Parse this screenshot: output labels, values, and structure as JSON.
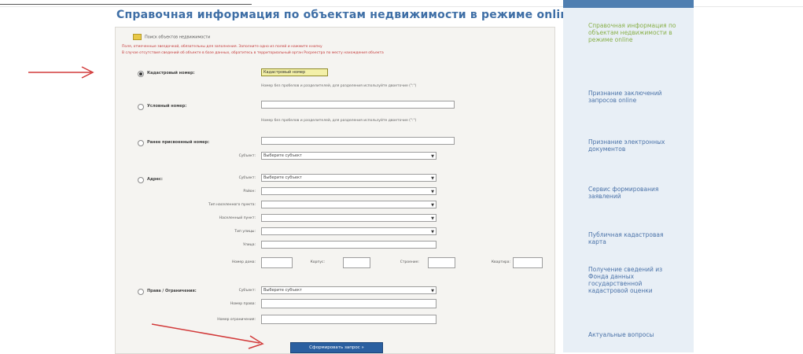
{
  "page_title": "Справочная информация по объектам недвижимости в режиме online",
  "hint": "Поиск объектов недвижимости",
  "notices": [
    "Поля, отмеченные звездочкой, обязательны для заполнения. Заполните одно из полей и нажмите кнопку",
    "В случае отсутствия сведений об объекте в базе данных, обратитесь в территориальный орган Росреестра по месту нахождения объекта"
  ],
  "form": {
    "cadastral": {
      "label": "Кадастровый номер:",
      "value": "Кадастровый номер",
      "hint": "Номер без пробелов и разделителей, для разделения используйте двоеточие (\":\")"
    },
    "conditional": {
      "label": "Условный номер:",
      "hint": "Номер без пробелов и разделителей, для разделения используйте двоеточие (\":\")"
    },
    "old_number": {
      "label": "Ранее присвоенный номер:",
      "subject_label": "Субъект:",
      "subject_value": "Выберите субъект"
    },
    "address": {
      "label": "Адрес:",
      "rows": [
        {
          "label": "Субъект:",
          "value": "Выберите субъект",
          "type": "select"
        },
        {
          "label": "Район:",
          "value": "",
          "type": "select"
        },
        {
          "label": "Тип населенного пункта:",
          "value": "",
          "type": "select"
        },
        {
          "label": "Населенный пункт:",
          "value": "",
          "type": "select"
        },
        {
          "label": "Тип улицы:",
          "value": "",
          "type": "select"
        },
        {
          "label": "Улица:",
          "value": "",
          "type": "input"
        }
      ],
      "house_label": "Номер дома:",
      "corpus_label": "Корпус:",
      "building_label": "Строение:",
      "apartment_label": "Квартира:"
    },
    "rights": {
      "label": "Права / Ограничения:",
      "subject_label": "Субъект:",
      "subject_value": "Выберите субъект",
      "right_number_label": "Номер права:",
      "restriction_number_label": "Номер ограничения:"
    },
    "submit_label": "Сформировать запрос »"
  },
  "sidebar": {
    "items": [
      {
        "label": "Справочная информация по объектам недвижимости в режиме online",
        "active": true
      },
      {
        "label": "Признание заключений запросов online",
        "active": false
      },
      {
        "label": "Признание электронных документов",
        "active": false
      },
      {
        "label": "Сервис формирования заявлений",
        "active": false
      },
      {
        "label": "Публичная кадастровая карта",
        "active": false
      },
      {
        "label": "Получение сведений из Фонда данных государственной кадастровой оценки",
        "active": false
      },
      {
        "label": "Актуальные вопросы",
        "active": false
      }
    ]
  },
  "colors": {
    "title": "#3f6fa6",
    "sidebar_link": "#4a72a8",
    "sidebar_active": "#8ab04a",
    "button": "#2a5fa0",
    "arrow": "#d23a3a"
  }
}
